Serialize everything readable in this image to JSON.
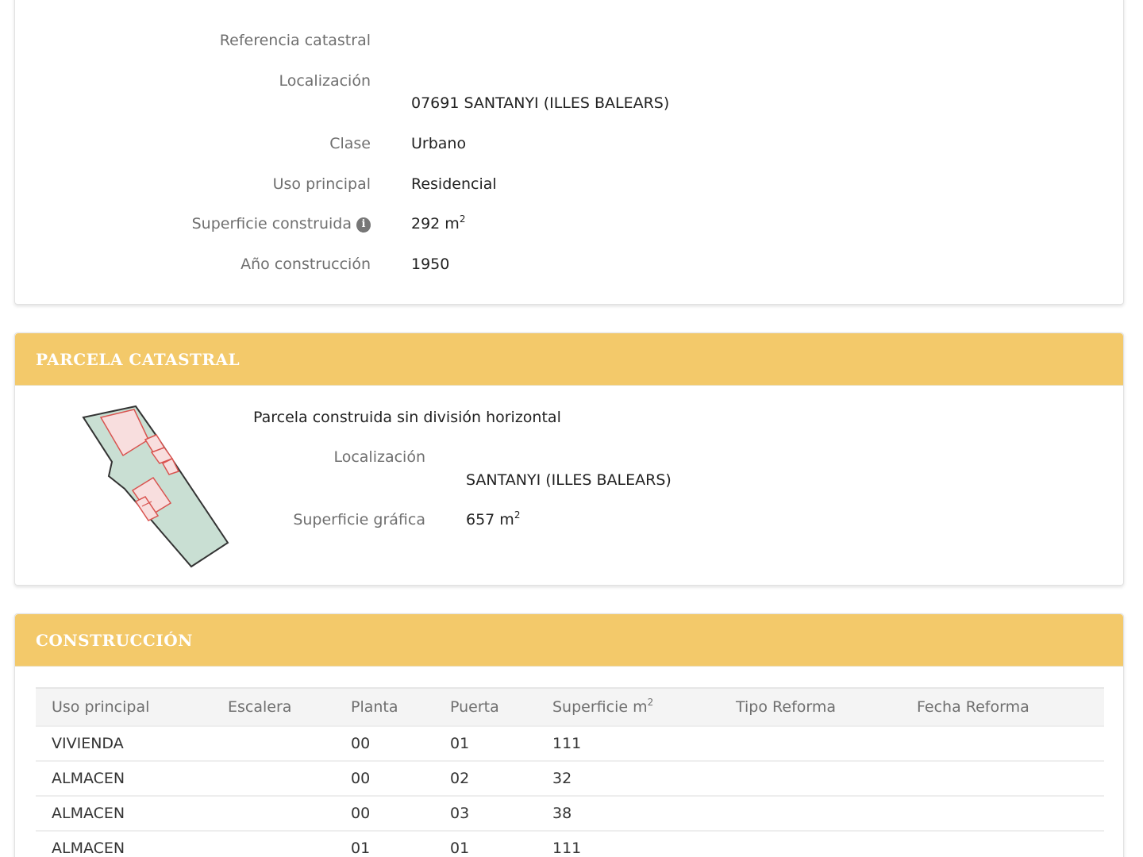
{
  "inmueble": {
    "referencia_label": "Referencia catastral",
    "localizacion_label": "Localización",
    "localizacion_value": "07691 SANTANYI (ILLES BALEARS)",
    "clase_label": "Clase",
    "clase_value": "Urbano",
    "uso_label": "Uso principal",
    "uso_value": "Residencial",
    "superficie_label": "Superficie construida",
    "superficie_value": "292 m",
    "superficie_unit_exp": "2",
    "info_icon": "info-icon",
    "anio_label": "Año construcción",
    "anio_value": "1950"
  },
  "parcela": {
    "title": "PARCELA CATASTRAL",
    "tipo": "Parcela construida sin división horizontal",
    "localizacion_label": "Localización",
    "localizacion_value": "SANTANYI (ILLES BALEARS)",
    "superficie_label": "Superficie gráfica",
    "superficie_value": "657 m",
    "superficie_unit_exp": "2",
    "map_colors": {
      "parcel_fill": "#c9dfd3",
      "parcel_stroke": "#333333",
      "building_fill": "#f8dede",
      "building_stroke": "#d9534f"
    }
  },
  "construccion": {
    "title": "CONSTRUCCIÓN",
    "headers": [
      "Uso principal",
      "Escalera",
      "Planta",
      "Puerta",
      "Superficie m",
      "Tipo Reforma",
      "Fecha Reforma"
    ],
    "superficie_header_exp": "2",
    "rows": [
      [
        "VIVIENDA",
        "",
        "00",
        "01",
        "111",
        "",
        ""
      ],
      [
        "ALMACEN",
        "",
        "00",
        "02",
        "32",
        "",
        ""
      ],
      [
        "ALMACEN",
        "",
        "00",
        "03",
        "38",
        "",
        ""
      ],
      [
        "ALMACEN",
        "",
        "01",
        "01",
        "111",
        "",
        ""
      ]
    ]
  },
  "colors": {
    "header_bg": "#f3c96a",
    "header_text": "#ffffff"
  }
}
